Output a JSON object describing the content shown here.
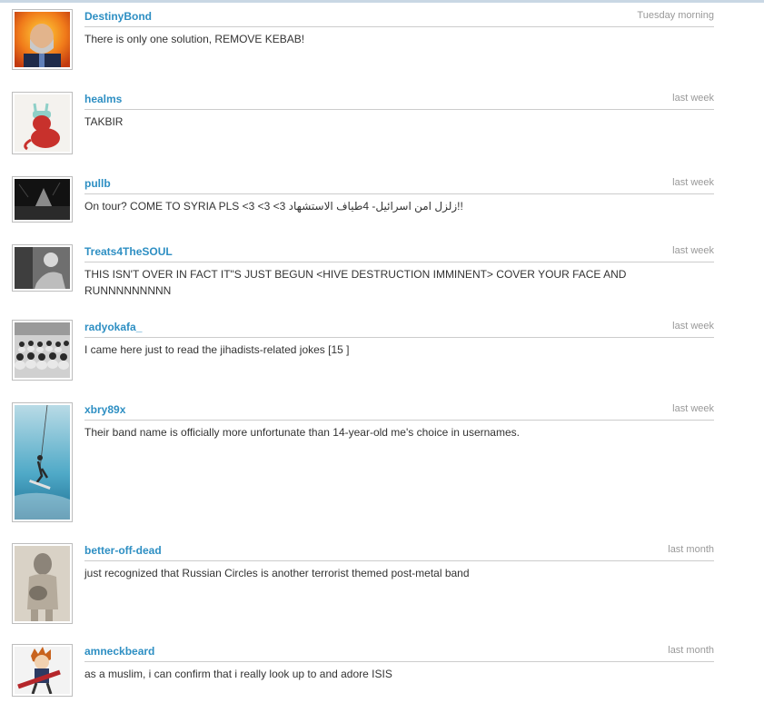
{
  "comments": [
    {
      "username": "DestinyBond",
      "time": "Tuesday morning",
      "text": "There is only one solution, REMOVE KEBAB!"
    },
    {
      "username": "healms",
      "time": "last week",
      "text": "TAKBIR"
    },
    {
      "username": "pullb",
      "time": "last week",
      "text": "On tour? COME TO SYRIA PLS <3 <3 <3 زلزل امن اسرائيل- 4طياف الاستشهاد!!"
    },
    {
      "username": "Treats4TheSOUL",
      "time": "last week",
      "text": "THIS ISN'T OVER IN FACT IT\"S JUST BEGUN <HIVE DESTRUCTION IMMINENT> COVER YOUR FACE AND RUNNNNNNNNN"
    },
    {
      "username": "radyokafa_",
      "time": "last week",
      "text": "I came here just to read the jihadists-related jokes [15 ]"
    },
    {
      "username": "xbry89x",
      "time": "last week",
      "text": "Their band name is officially more unfortunate than 14-year-old me's choice in usernames."
    },
    {
      "username": "better-off-dead",
      "time": "last month",
      "text": "just recognized that Russian Circles is another terrorist themed post-metal band"
    },
    {
      "username": "amneckbeard",
      "time": "last month",
      "text": "as a muslim, i can confirm that i really look up to and adore ISIS"
    }
  ],
  "colors": {
    "username": "#2e8fc3",
    "timestamp": "#999999",
    "body_text": "#333333",
    "divider": "#cccccc"
  }
}
